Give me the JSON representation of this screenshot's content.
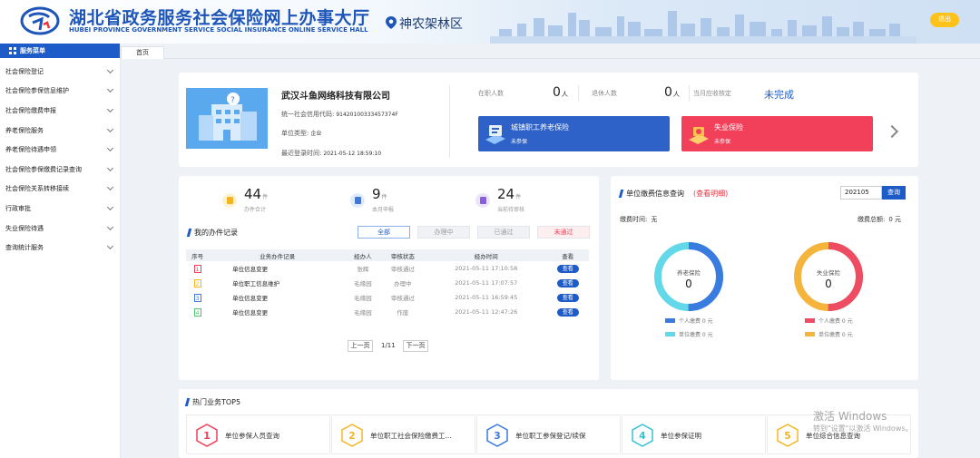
{
  "header": {
    "title_cn": "湖北省政务服务社会保险网上办事大厅",
    "title_en": "HUBEI PROVINCE GOVERNMENT SERVICE SOCIAL INSURANCE ONLINE SERVICE HALL",
    "region": "神农架林区",
    "logout_label": "退出",
    "brand_color": "#1d55b8"
  },
  "sidebar": {
    "title": "服务菜单",
    "items": [
      "社会保险登记",
      "社会保险参保信息维护",
      "社会保险缴费申报",
      "养老保险服务",
      "养老保险待遇申领",
      "社会保险参保缴费记录查询",
      "社会保险关系转移接续",
      "行政审批",
      "失业保险待遇",
      "查询统计服务"
    ]
  },
  "tabs": {
    "home": "首页"
  },
  "company": {
    "name": "武汉斗鱼网络科技有限公司",
    "credit_code_label": "统一社会信用代码:",
    "credit_code": "91420100333457374F",
    "type_label": "单位类型:",
    "type": "企业",
    "last_login_label": "最近登录时间:",
    "last_login": "2021-05-12 18:59:10"
  },
  "stats": {
    "active_label": "在职人数",
    "active_value": "0",
    "retired_label": "退休人数",
    "retired_value": "0",
    "unit": "人",
    "status_label": "当月应收核定",
    "status_value": "未完成"
  },
  "insurance": [
    {
      "name": "城镇职工养老保险",
      "status": "未参保",
      "color": "#2e62c8"
    },
    {
      "name": "失业保险",
      "status": "未参保",
      "color": "#f2405a"
    }
  ],
  "task_stats": [
    {
      "value": "44",
      "unit": "件",
      "label": "办件合计",
      "color": "#f5b523"
    },
    {
      "value": "9",
      "unit": "件",
      "label": "本月申报",
      "color": "#3c7ae0"
    },
    {
      "value": "24",
      "unit": "件",
      "label": "当前待审核",
      "color": "#8b5be0"
    }
  ],
  "tasks": {
    "title": "我的办件记录",
    "filters": [
      "全部",
      "办理中",
      "已通过",
      "未通过"
    ],
    "columns": [
      "序号",
      "业务办件记录",
      "经办人",
      "审核状态",
      "经办时间",
      "查看"
    ],
    "rows": [
      {
        "no": "1",
        "name": "单位信息变更",
        "handler": "张辉",
        "status": "审核通过",
        "time": "2021-05-11 17:10:58",
        "action": "查看"
      },
      {
        "no": "2",
        "name": "单位职工信息维护",
        "handler": "毛缘园",
        "status": "办理中",
        "time": "2021-05-11 17:07:57",
        "action": "查看"
      },
      {
        "no": "3",
        "name": "单位信息变更",
        "handler": "毛缘园",
        "status": "审核通过",
        "time": "2021-05-11 16:59:45",
        "action": "查看"
      },
      {
        "no": "4",
        "name": "单位信息变更",
        "handler": "毛缘园",
        "status": "作废",
        "time": "2021-05-11 12:47:26",
        "action": "查看"
      }
    ],
    "prev": "上一页",
    "page": "1/11",
    "next": "下一页"
  },
  "payment": {
    "title": "单位缴费信息查询",
    "detail_link": "(查看明细)",
    "year_value": "202105",
    "query_label": "查询",
    "time_label": "缴费时间:",
    "time_value": "无",
    "total_label": "缴费总额:",
    "total_value": "0 元",
    "charts": [
      {
        "name": "养老保险",
        "value": "0",
        "colors": [
          "#3a7be0",
          "#63d8e8"
        ],
        "legend": [
          "个人缴费 0 元",
          "单位缴费 0 元"
        ]
      },
      {
        "name": "失业保险",
        "value": "0",
        "colors": [
          "#ee4c62",
          "#f5b53c"
        ],
        "legend": [
          "个人缴费 0 元",
          "单位缴费 0 元"
        ]
      }
    ]
  },
  "hot": {
    "title": "热门业务TOP5",
    "items": [
      {
        "no": "1",
        "name": "单位参保人员查询",
        "color": "#f2405a"
      },
      {
        "no": "2",
        "name": "单位职工社会保险缴费工...",
        "color": "#f5b523"
      },
      {
        "no": "3",
        "name": "单位职工参保登记/续保",
        "color": "#3c7ae0"
      },
      {
        "no": "4",
        "name": "单位参保证明",
        "color": "#35c3d4"
      },
      {
        "no": "5",
        "name": "单位综合信息查询",
        "color": "#f5b523"
      }
    ]
  },
  "watermark": {
    "line1": "激活 Windows",
    "line2": "转到\"设置\"以激活 Windows。"
  }
}
